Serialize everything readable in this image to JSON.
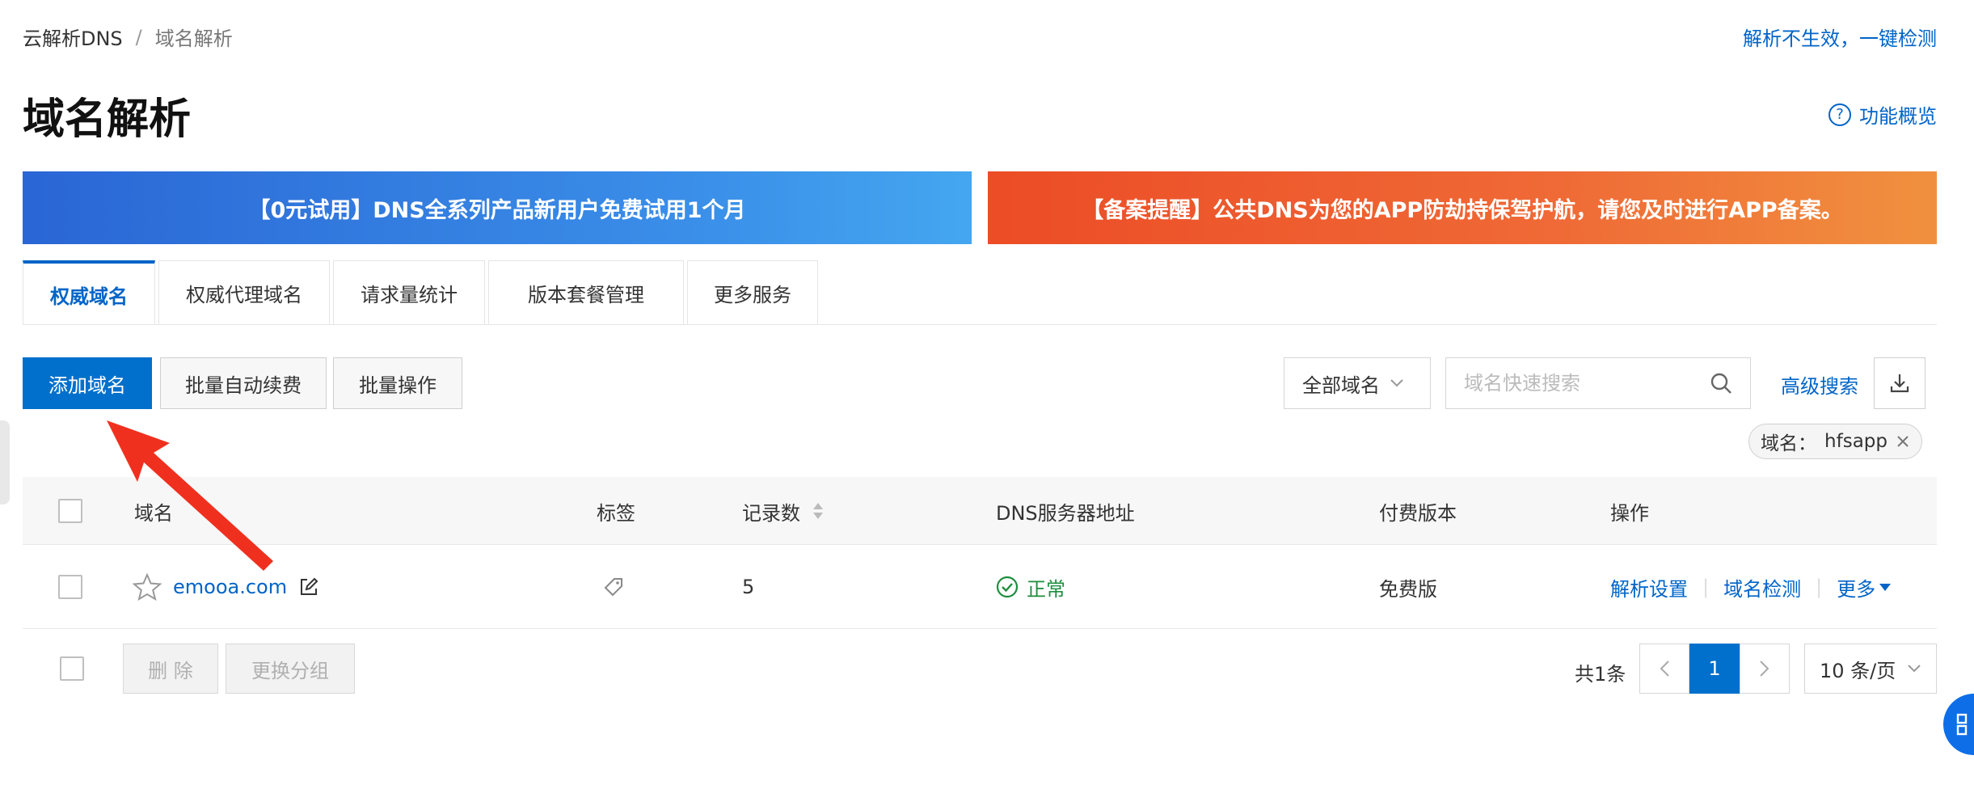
{
  "breadcrumb": {
    "root": "云解析DNS",
    "separator": "/",
    "current": "域名解析"
  },
  "top_link": "解析不生效，一键检测",
  "page_title": "域名解析",
  "overview_link": "功能概览",
  "banners": {
    "left": "【0元试用】DNS全系列产品新用户免费试用1个月",
    "right": "【备案提醒】公共DNS为您的APP防劫持保驾护航，请您及时进行APP备案。"
  },
  "tabs": [
    {
      "label": "权威域名",
      "active": true
    },
    {
      "label": "权威代理域名"
    },
    {
      "label": "请求量统计"
    },
    {
      "label": "版本套餐管理"
    },
    {
      "label": "更多服务"
    }
  ],
  "toolbar": {
    "add_domain": "添加域名",
    "batch_renew": "批量自动续费",
    "batch_ops": "批量操作",
    "filter_select": "全部域名",
    "search_placeholder": "域名快速搜索",
    "advanced_search": "高级搜索"
  },
  "filter_chip": {
    "label": "域名：",
    "value": "hfsapp"
  },
  "table": {
    "headers": {
      "domain": "域名",
      "tag": "标签",
      "records": "记录数",
      "dns_server": "DNS服务器地址",
      "edition": "付费版本",
      "actions": "操作"
    },
    "rows": [
      {
        "domain": "emooa.com",
        "records": "5",
        "dns_status": "正常",
        "edition": "免费版",
        "actions": [
          "解析设置",
          "域名检测",
          "更多"
        ]
      }
    ]
  },
  "footer": {
    "delete": "删 除",
    "change_group": "更换分组",
    "total": "共1条",
    "current_page": "1",
    "page_size": "10 条/页"
  },
  "colors": {
    "primary": "#0070cc",
    "link": "#0064c8",
    "success": "#1e8e3e",
    "annotation_arrow": "#f0301f"
  }
}
